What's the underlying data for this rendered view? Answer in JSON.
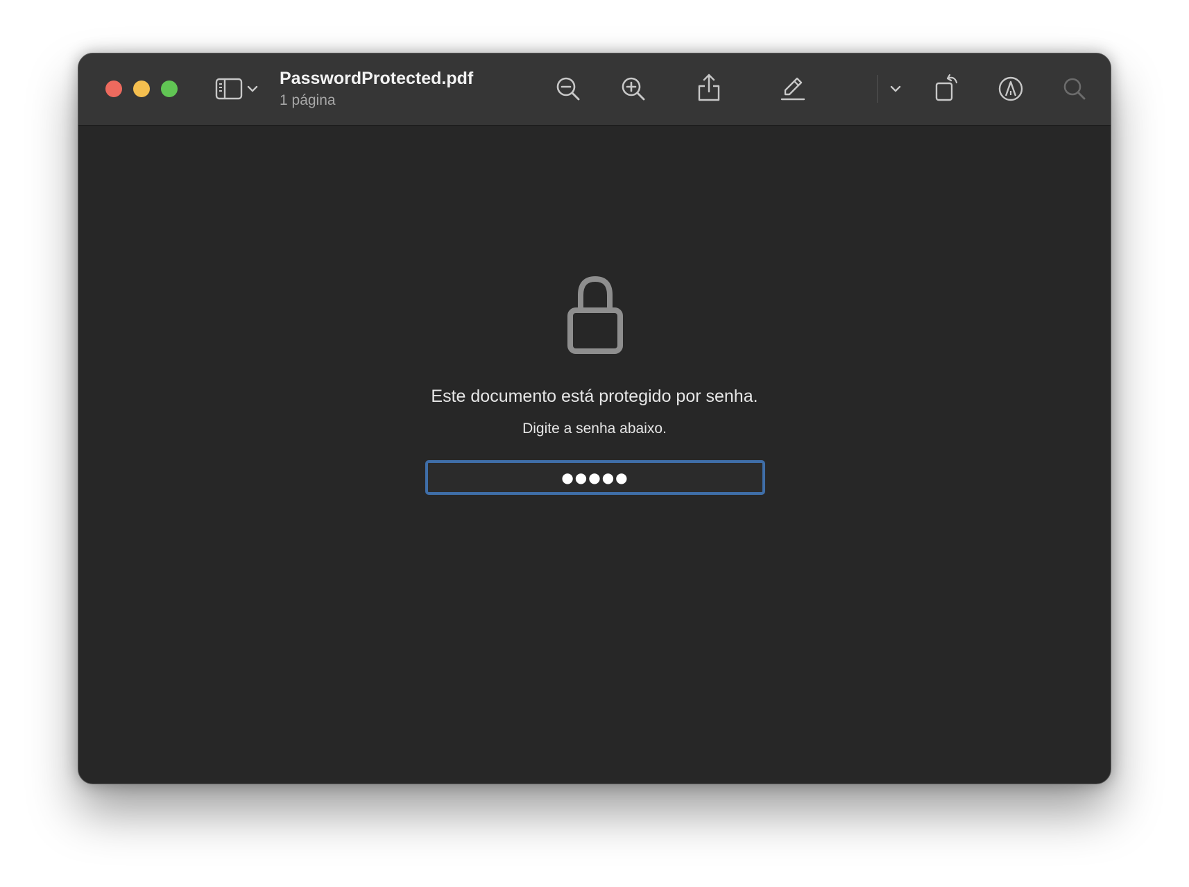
{
  "window": {
    "title": "PasswordProtected.pdf",
    "subtitle": "1 página"
  },
  "toolbar": {
    "buttons": [
      {
        "name": "sidebar-toggle",
        "icon": "sidebar-icon"
      },
      {
        "name": "sidebar-menu",
        "icon": "chevron-down-icon"
      },
      {
        "name": "zoom-out",
        "icon": "zoom-out-icon"
      },
      {
        "name": "zoom-in",
        "icon": "zoom-in-icon"
      },
      {
        "name": "share",
        "icon": "share-icon"
      },
      {
        "name": "highlight",
        "icon": "pencil-icon"
      },
      {
        "name": "highlight-menu",
        "icon": "chevron-down-icon"
      },
      {
        "name": "rotate",
        "icon": "rotate-icon"
      },
      {
        "name": "markup",
        "icon": "markup-icon"
      },
      {
        "name": "search",
        "icon": "search-icon"
      }
    ]
  },
  "content": {
    "lock_icon": "lock-icon",
    "message": "Este documento está protegido por senha.",
    "instruction": "Digite a senha abaixo.",
    "password_value": "●●●●●"
  },
  "colors": {
    "window_bg": "#272727",
    "toolbar_bg": "#363636",
    "close": "#ed6a5e",
    "minimize": "#f5bf4f",
    "maximize": "#61c554",
    "focus_ring": "#3f6ea8"
  }
}
